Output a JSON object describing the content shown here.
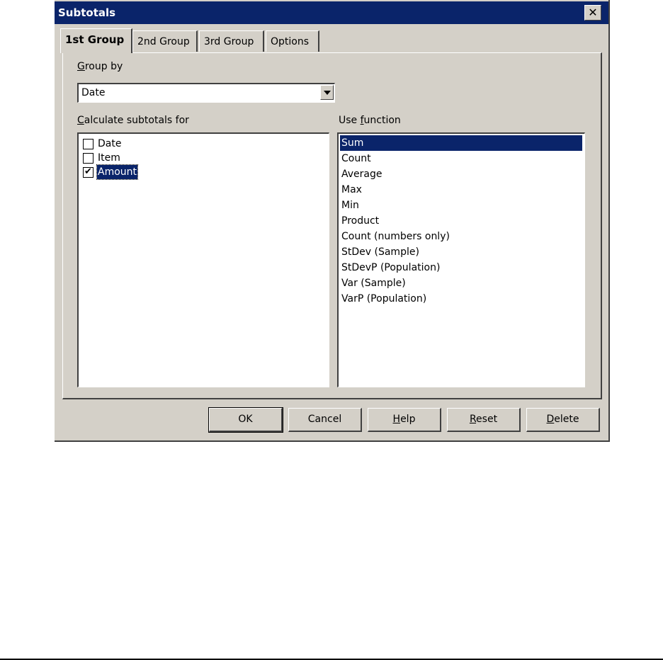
{
  "window": {
    "title": "Subtotals",
    "close_symbol": "✕"
  },
  "tabs": [
    {
      "label": "1st Group",
      "active": true
    },
    {
      "label": "2nd Group",
      "active": false
    },
    {
      "label": "3rd Group",
      "active": false
    },
    {
      "label": "Options",
      "active": false
    }
  ],
  "group_by": {
    "mnemonic": "G",
    "label_rest": "roup by",
    "value": "Date"
  },
  "calculate": {
    "mnemonic": "C",
    "label_rest": "alculate subtotals for",
    "items": [
      {
        "label": "Date",
        "checked": false,
        "mark": ""
      },
      {
        "label": "Item",
        "checked": false,
        "mark": ""
      },
      {
        "label": "Amount",
        "checked": true,
        "mark": "✔"
      }
    ]
  },
  "use_function": {
    "label_pre": "Use ",
    "mnemonic": "f",
    "label_rest": "unction",
    "items": [
      "Sum",
      "Count",
      "Average",
      "Max",
      "Min",
      "Product",
      "Count (numbers only)",
      "StDev (Sample)",
      "StDevP (Population)",
      "Var (Sample)",
      "VarP (Population)"
    ],
    "selected": "Sum"
  },
  "buttons": {
    "ok": "OK",
    "cancel": "Cancel",
    "help": {
      "mnemonic": "H",
      "rest": "elp"
    },
    "reset": {
      "mnemonic": "R",
      "rest": "eset"
    },
    "delete": {
      "mnemonic": "D",
      "rest": "elete"
    }
  },
  "colors": {
    "dialog_bg": "#d4d0c8",
    "titlebar": "#0a246a",
    "selection": "#0a246a"
  }
}
